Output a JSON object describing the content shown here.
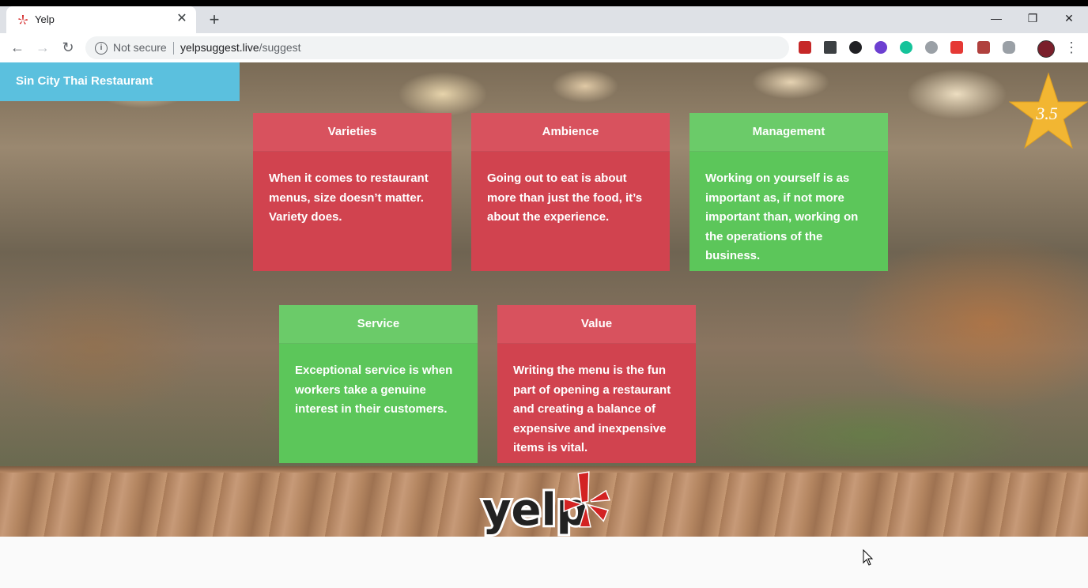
{
  "browser": {
    "tab_title": "Yelp",
    "tab_close": "✕",
    "new_tab": "+",
    "win_minimize": "—",
    "win_restore": "❐",
    "win_close": "✕",
    "security_label": "Not secure",
    "url_host": "yelpsuggest.live",
    "url_path": "/suggest"
  },
  "restaurant": {
    "name": "Sin City Thai Restaurant",
    "rating": "3.5"
  },
  "cards": [
    {
      "title": "Varieties",
      "text": "When it comes to restaurant menus, size doesn’t matter. Variety does.",
      "color": "red"
    },
    {
      "title": "Ambience",
      "text": "Going out to eat is about more than just the food, it’s about the experience.",
      "color": "red"
    },
    {
      "title": "Management",
      "text": "Working on yourself is as important as, if not more important than, working on the operations of the business.",
      "color": "green"
    },
    {
      "title": "Service",
      "text": "Exceptional service is when workers take a genuine interest in their customers.",
      "color": "green"
    },
    {
      "title": "Value",
      "text": "Writing the menu is the fun part of opening a restaurant and creating a balance of expensive and inexpensive items is vital.",
      "color": "red"
    }
  ],
  "logo": {
    "text": "yelp"
  },
  "colors": {
    "red_card": "#d1434f",
    "green_card": "#5cc65a",
    "name_bar": "#5bc0de",
    "star": "#f2b632"
  }
}
